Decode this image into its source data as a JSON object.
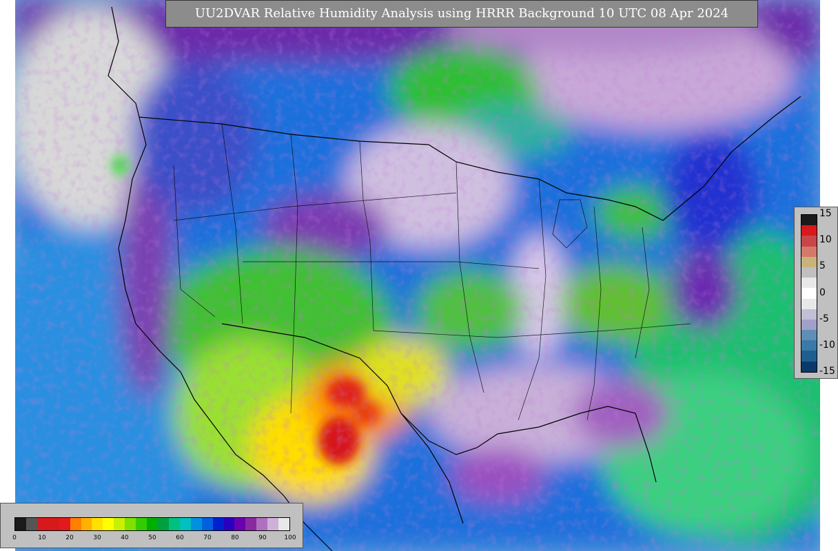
{
  "title": "UU2DVAR Relative Humidity Analysis using HRRR Background 10 UTC 08 Apr 2024",
  "rh_legend": {
    "ticks": [
      "0",
      "10",
      "20",
      "30",
      "40",
      "50",
      "60",
      "70",
      "80",
      "90",
      "100"
    ],
    "colors": [
      "#1a1a1a",
      "#555555",
      "#d7191c",
      "#d7191c",
      "#e31a1c",
      "#ff7f00",
      "#ffb000",
      "#ffe000",
      "#ffff00",
      "#c8f000",
      "#80e000",
      "#33cc00",
      "#00b000",
      "#00a040",
      "#00c080",
      "#00c0c0",
      "#0090e0",
      "#0060e0",
      "#0020d0",
      "#2a00c0",
      "#6a00b0",
      "#8a2aa0",
      "#b070c0",
      "#d0b0d8",
      "#e8e8e8"
    ]
  },
  "diff_legend": {
    "ticks": [
      "15",
      "10",
      "5",
      "0",
      "-5",
      "-10",
      "-15"
    ],
    "colors": [
      "#1a1a1a",
      "#d7191c",
      "#c8464a",
      "#d47a6a",
      "#c8b47a",
      "#bfbfbf",
      "#e8e8e8",
      "#ffffff",
      "#e8e8e8",
      "#c0bfd6",
      "#a0a0c8",
      "#5f8fb5",
      "#3a7aa8",
      "#1f5f90",
      "#0a3a6a"
    ]
  }
}
